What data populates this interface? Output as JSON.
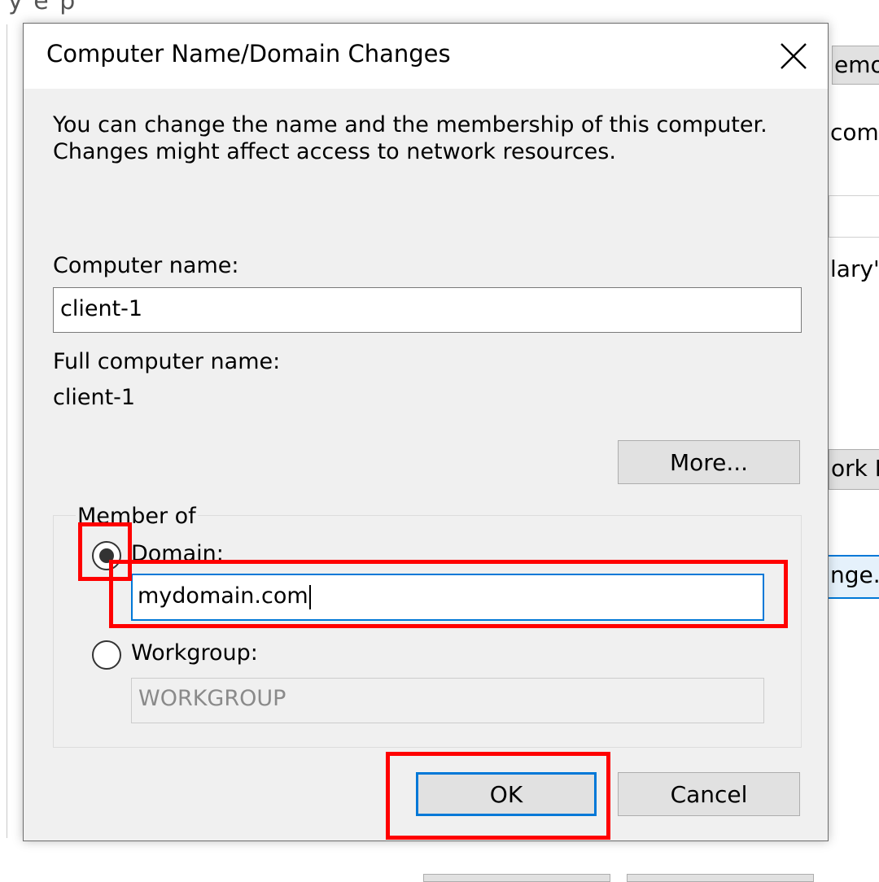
{
  "background": {
    "title_fragment": "y  e  p",
    "right_labels": {
      "remote_tab": "emote",
      "comp_text": "comp",
      "users_text": "lary's",
      "network_id": "ork ID",
      "change_button": "nge..."
    }
  },
  "dialog": {
    "title": "Computer Name/Domain Changes",
    "description": "You can change the name and the membership of this computer. Changes might affect access to network resources.",
    "computer_name_label": "Computer name:",
    "computer_name_value": "client-1",
    "full_name_label": "Full computer name:",
    "full_name_value": "client-1",
    "more_button": "More...",
    "member_of_label": "Member of",
    "domain_label": "Domain:",
    "domain_value": "mydomain.com",
    "domain_selected": true,
    "workgroup_label": "Workgroup:",
    "workgroup_value": "WORKGROUP",
    "ok_button": "OK",
    "cancel_button": "Cancel"
  },
  "colors": {
    "dialog_bg": "#f0f0f0",
    "accent_blue": "#0078d7",
    "annotation_red": "#ff0000"
  },
  "icons": [
    "close-icon",
    "radio-selected-icon",
    "radio-unselected-icon"
  ]
}
